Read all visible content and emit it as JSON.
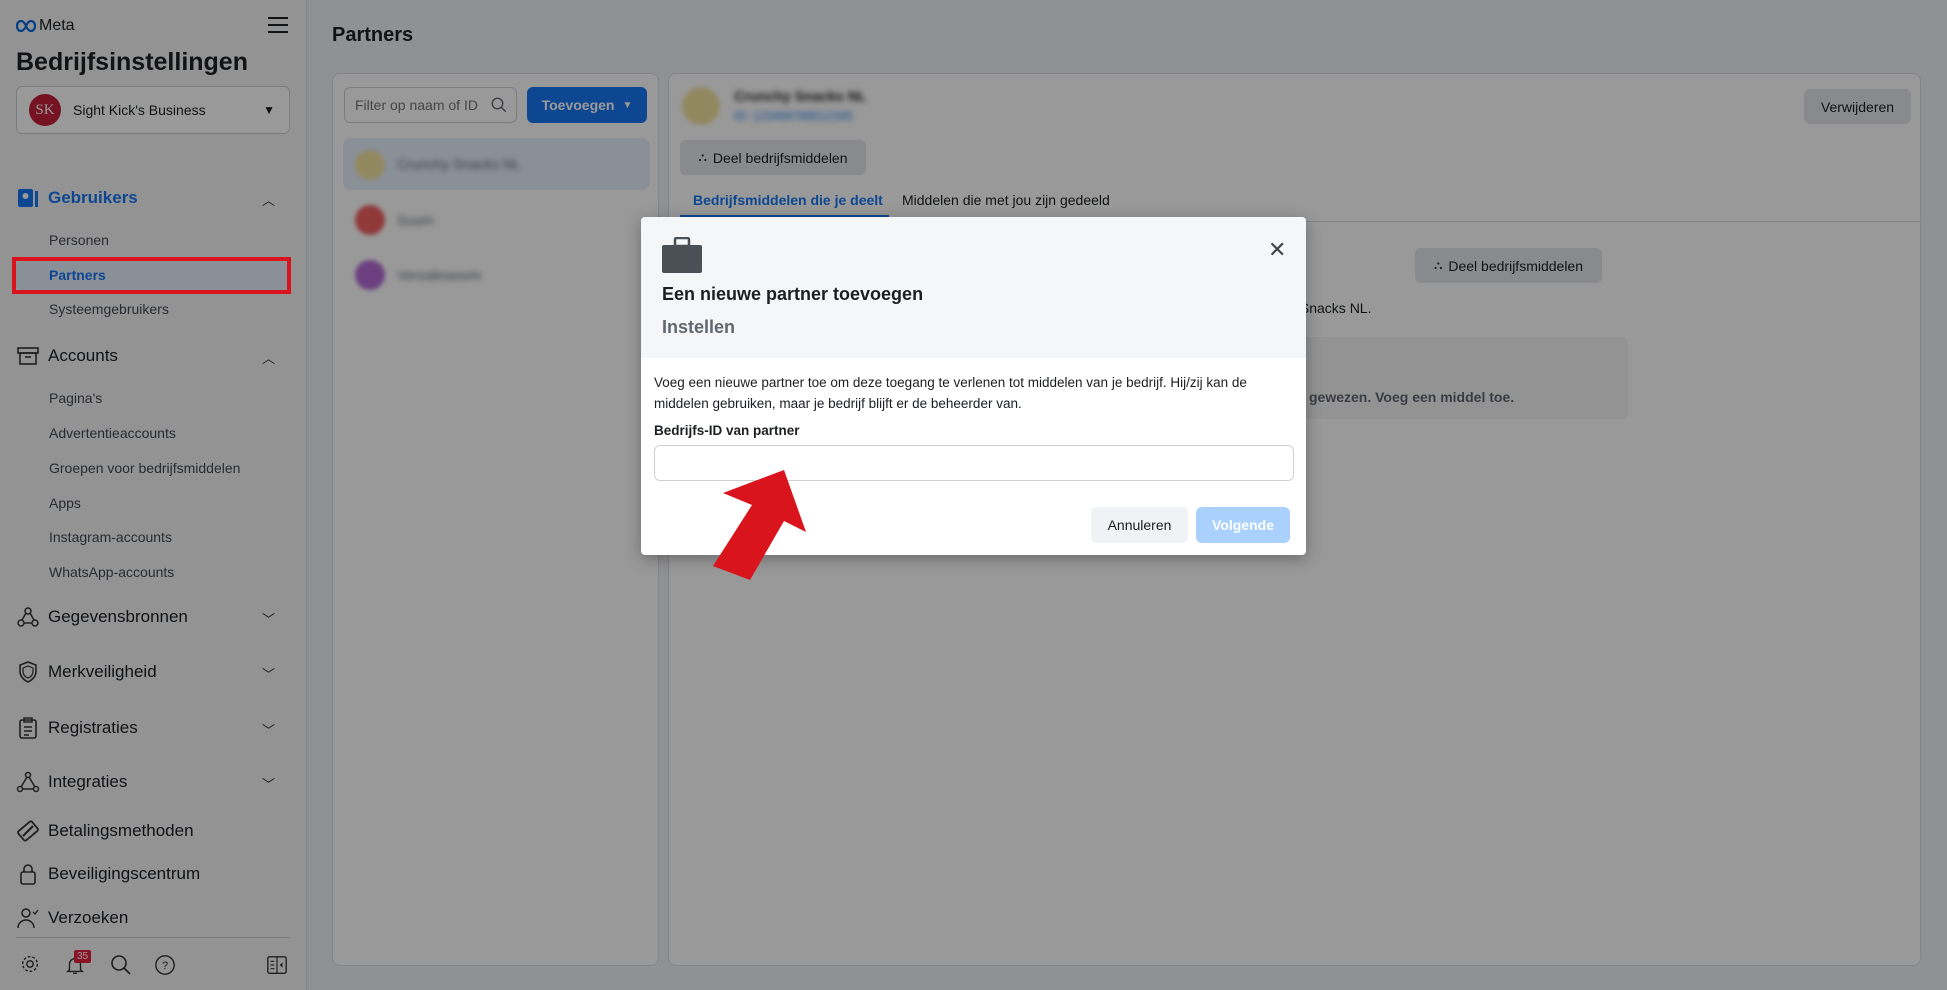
{
  "sidebar": {
    "brand": "Meta",
    "title": "Bedrijfsinstellingen",
    "business": {
      "initials": "SK",
      "name": "Sight Kick's Business"
    },
    "groups": [
      {
        "label": "Gebruikers",
        "items": [
          "Personen",
          "Partners",
          "Systeemgebruikers"
        ]
      },
      {
        "label": "Accounts",
        "items": [
          "Pagina's",
          "Advertentieaccounts",
          "Groepen voor bedrijfsmiddelen",
          "Apps",
          "Instagram-accounts",
          "WhatsApp-accounts"
        ]
      }
    ],
    "sections": [
      "Gegevensbronnen",
      "Merkveiligheid",
      "Registraties",
      "Integraties",
      "Betalingsmethoden",
      "Beveiligingscentrum",
      "Verzoeken"
    ],
    "notification_count": "35",
    "accent": "#1877f2"
  },
  "main": {
    "title": "Partners",
    "filter_placeholder": "Filter op naam of ID",
    "add_button": "Toevoegen",
    "partners": [
      "Crunchy Snacks NL",
      "Suum",
      "Verzalewoom"
    ],
    "detail": {
      "name": "Crunchy Snacks NL",
      "id_link": "ID: 123456789012345",
      "remove_button": "Verwijderen",
      "share_button": "Deel bedrijfsmiddelen",
      "tabs": [
        "Bedrijfsmiddelen die je deelt",
        "Middelen die met jou zijn gedeeld"
      ],
      "share_button_2": "Deel bedrijfsmiddelen",
      "partial_text": "y Snacks NL.",
      "empty_text": "gewezen. Voeg een middel toe."
    }
  },
  "modal": {
    "title": "Een nieuwe partner toevoegen",
    "step": "Instellen",
    "description": "Voeg een nieuwe partner toe om deze toegang te verlenen tot middelen van je bedrijf. Hij/zij kan de middelen gebruiken, maar je bedrijf blijft er de beheerder van.",
    "field_label": "Bedrijfs-ID van partner",
    "field_value": "",
    "cancel": "Annuleren",
    "next": "Volgende"
  },
  "annotation_color": "#d9141c"
}
